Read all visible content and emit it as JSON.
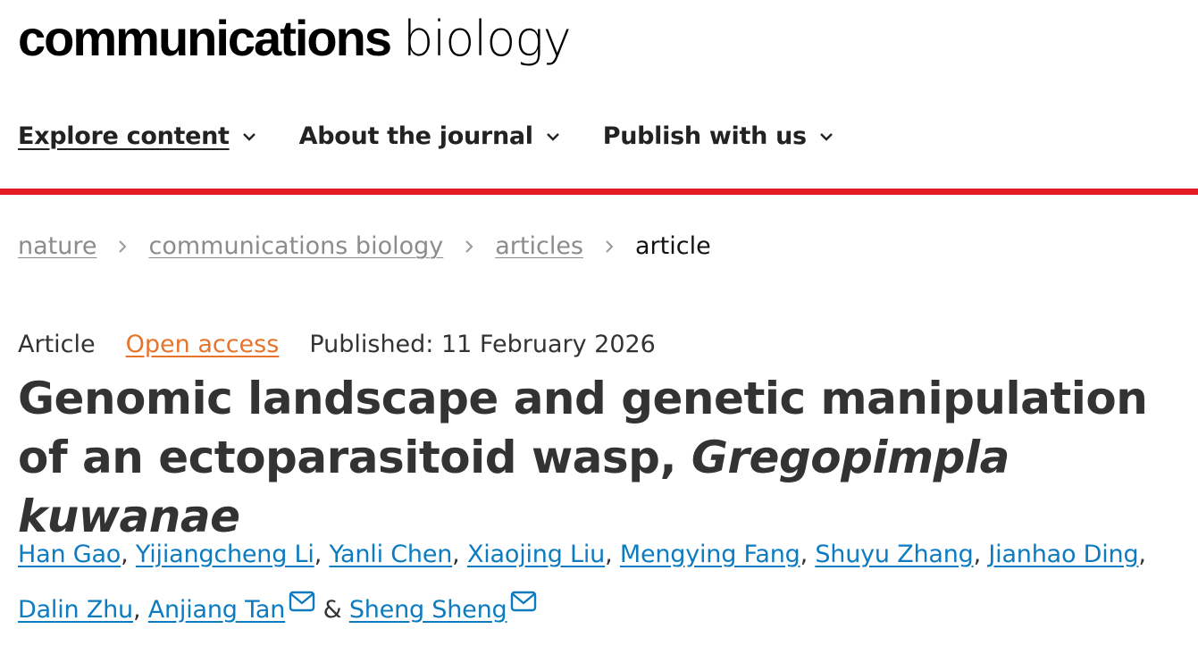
{
  "header": {
    "logo_bold": "communications",
    "logo_light": "biology"
  },
  "nav": {
    "items": [
      {
        "label": "Explore content"
      },
      {
        "label": "About the journal"
      },
      {
        "label": "Publish with us"
      }
    ]
  },
  "breadcrumb": {
    "items": [
      "nature",
      "communications biology",
      "articles"
    ],
    "current": "article"
  },
  "article": {
    "type": "Article",
    "access": "Open access",
    "published": "Published: 11 February 2026",
    "title_main": "Genomic landscape and genetic manipulation of an ectoparasitoid wasp, ",
    "title_italic": "Gregopimpla kuwanae"
  },
  "authors": {
    "list": [
      "Han Gao",
      "Yijiangcheng Li",
      "Yanli Chen",
      "Xiaojing Liu",
      "Mengying Fang",
      "Shuyu Zhang",
      "Jianhao Ding",
      "Dalin Zhu",
      "Anjiang Tan",
      "Sheng Sheng"
    ],
    "separator": ", ",
    "conjunction": " & "
  },
  "colors": {
    "accent_bar": "#e31b23",
    "open_access": "#e8742c",
    "author_link": "#0c7bc0"
  }
}
